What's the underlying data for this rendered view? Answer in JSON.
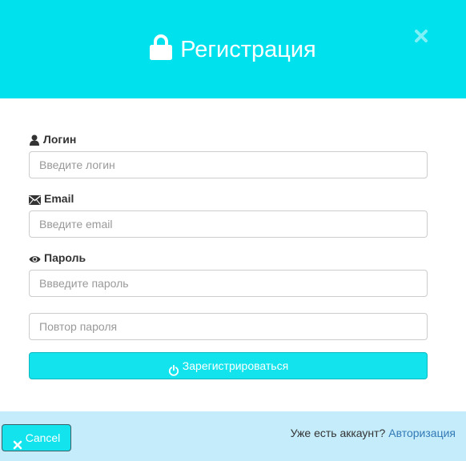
{
  "header": {
    "title": "Регистрация",
    "icon": "lock-icon",
    "close_icon": "close-icon",
    "background": "#00e1ee"
  },
  "form": {
    "login": {
      "label": "Логин",
      "icon": "user-icon",
      "placeholder": "Введите логин",
      "value": ""
    },
    "email": {
      "label": "Email",
      "icon": "envelope-icon",
      "placeholder": "Введите email",
      "value": ""
    },
    "password": {
      "label": "Пароль",
      "icon": "eye-icon",
      "placeholder": "Ввведите пароль",
      "value": ""
    },
    "password_repeat": {
      "placeholder": "Повтор пароля",
      "value": ""
    },
    "submit": {
      "label": "Зарегистрироваться",
      "icon": "power-icon"
    }
  },
  "footer": {
    "cancel_label": "Cancel",
    "cancel_icon": "close-icon",
    "prompt_text": "Уже есть аккаунт?",
    "login_link": "Авторизация",
    "background": "#c4ecfa"
  }
}
